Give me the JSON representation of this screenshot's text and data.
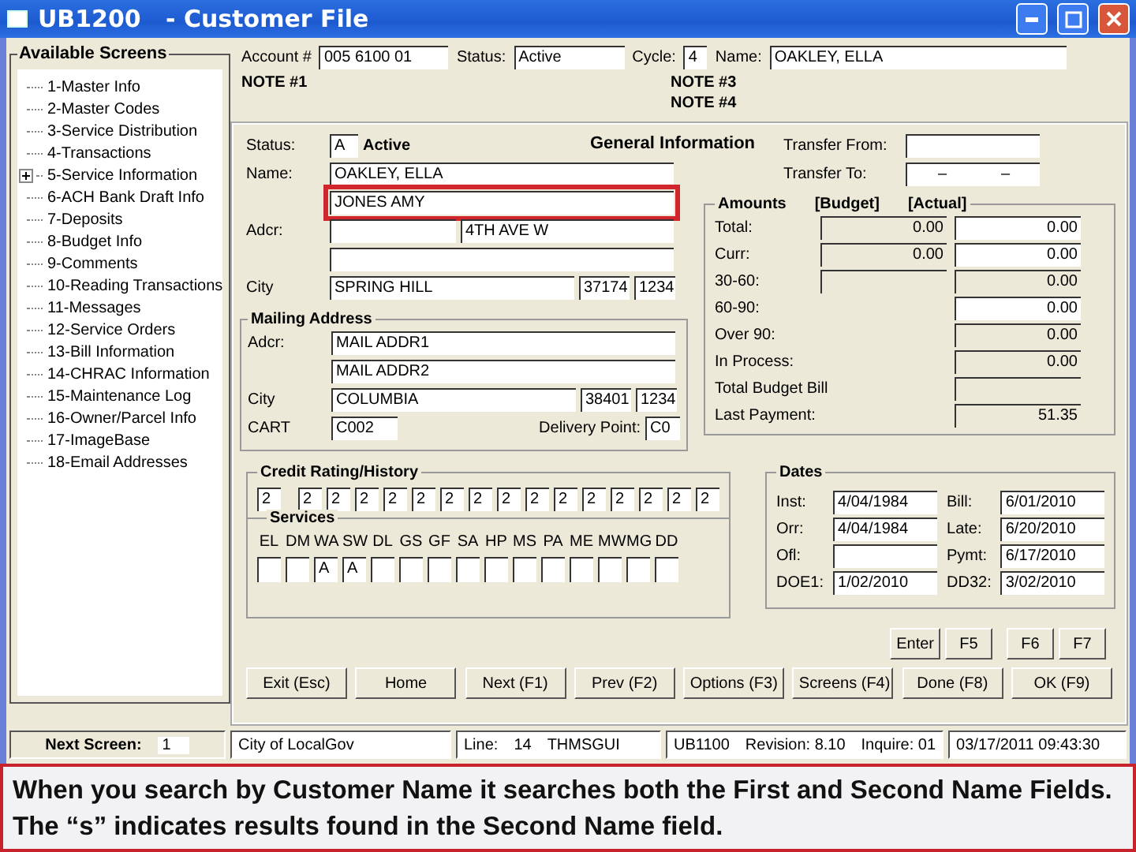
{
  "window": {
    "title": "UB1200   - Customer File"
  },
  "screens": {
    "title": "Available Screens",
    "items": [
      {
        "label": "1-Master Info",
        "expandable": false
      },
      {
        "label": "2-Master Codes",
        "expandable": false
      },
      {
        "label": "3-Service Distribution",
        "expandable": false
      },
      {
        "label": "4-Transactions",
        "expandable": false
      },
      {
        "label": "5-Service Information",
        "expandable": true
      },
      {
        "label": "6-ACH Bank Draft Info",
        "expandable": false
      },
      {
        "label": "7-Deposits",
        "expandable": false
      },
      {
        "label": "8-Budget Info",
        "expandable": false
      },
      {
        "label": "9-Comments",
        "expandable": false
      },
      {
        "label": "10-Reading Transactions",
        "expandable": false
      },
      {
        "label": "11-Messages",
        "expandable": false
      },
      {
        "label": "12-Service Orders",
        "expandable": false
      },
      {
        "label": "13-Bill Information",
        "expandable": false
      },
      {
        "label": "14-CHRAC Information",
        "expandable": false
      },
      {
        "label": "15-Maintenance Log",
        "expandable": false
      },
      {
        "label": "16-Owner/Parcel Info",
        "expandable": false
      },
      {
        "label": "17-ImageBase",
        "expandable": false
      },
      {
        "label": "18-Email Addresses",
        "expandable": false
      }
    ]
  },
  "header": {
    "account_label": "Account #",
    "account": "005  6100  01",
    "status_label": "Status:",
    "status": "Active",
    "cycle_label": "Cycle:",
    "cycle": "4",
    "name_label": "Name:",
    "name": "OAKLEY, ELLA"
  },
  "notes": {
    "left": [
      "NOTE #1"
    ],
    "right": [
      "NOTE #3",
      "NOTE #4"
    ]
  },
  "general": {
    "title": "General Information",
    "status_label": "Status:",
    "status_code": "A",
    "status_text": "Active",
    "name_label": "Name:",
    "names": [
      {
        "value": "OAKLEY, ELLA",
        "highlighted": false
      },
      {
        "value": "JONES  AMY",
        "highlighted": true
      }
    ],
    "addr_label": "Adcr:",
    "addr_lines": [
      {
        "kind": "split",
        "value": "4TH AVE W"
      },
      {
        "kind": "full"
      }
    ],
    "city_label": "City",
    "city": "SPRING HILL",
    "zip": "37174",
    "zip4": "1234",
    "transfer_from_label": "Transfer From:",
    "transfer_to_label": "Transfer To:",
    "transfer_to": [
      "–",
      "–"
    ]
  },
  "mailing": {
    "title": "Mailing Address",
    "addr_label": "Adcr:",
    "lines": [
      "MAIL ADDR1",
      "MAIL ADDR2"
    ],
    "city_label": "City",
    "city": "COLUMBIA",
    "zip": "38401",
    "zip4": "1234",
    "cart_label": "CART",
    "cart": "C002",
    "delivery_label": "Delivery Point:",
    "delivery": "C0"
  },
  "amounts": {
    "headings": [
      "Amounts",
      "[Budget]",
      "[Actual]"
    ],
    "rows": [
      {
        "label": "Total:",
        "budget_box": true,
        "budget": "0.00",
        "actual": "0.00"
      },
      {
        "label": "Curr:",
        "budget_box": true,
        "budget": "0.00",
        "actual": "0.00"
      },
      {
        "label": "30-60:",
        "budget_box": true,
        "actual": "0.00"
      },
      {
        "label": "60-90:",
        "budget_box": false,
        "actual": "0.00"
      },
      {
        "label": "Over 90:",
        "budget_box": false,
        "actual": "0.00"
      },
      {
        "label": "In Process:",
        "budget_box": false,
        "actual": "0.00"
      },
      {
        "label": "Total Budget Bill",
        "budget_box": false
      },
      {
        "label": "Last Payment:",
        "budget_box": false,
        "actual": "51.35"
      }
    ]
  },
  "credit": {
    "title": "Credit Rating/History",
    "values": [
      "2",
      "2",
      "2",
      "2",
      "2",
      "2",
      "2",
      "2",
      "2",
      "2",
      "2",
      "2",
      "2",
      "2",
      "2",
      "2"
    ]
  },
  "services": {
    "title": "Services",
    "items": [
      {
        "code": "EL"
      },
      {
        "code": "DM"
      },
      {
        "code": "WA",
        "value": "A"
      },
      {
        "code": "SW",
        "value": "A"
      },
      {
        "code": "DL"
      },
      {
        "code": "GS"
      },
      {
        "code": "GF"
      },
      {
        "code": "SA"
      },
      {
        "code": "HP"
      },
      {
        "code": "MS"
      },
      {
        "code": "PA"
      },
      {
        "code": "ME"
      },
      {
        "code": "MW"
      },
      {
        "code": "MG"
      },
      {
        "code": "DD"
      }
    ]
  },
  "dates": {
    "title": "Dates",
    "left": [
      {
        "label": "Inst:",
        "value": "4/04/1984"
      },
      {
        "label": "Orr:",
        "value": "4/04/1984"
      },
      {
        "label": "Ofl:"
      },
      {
        "label": "DOE1:",
        "value": "1/02/2010"
      }
    ],
    "right": [
      {
        "label": "Bill:",
        "value": "6/01/2010"
      },
      {
        "label": "Late:",
        "value": "6/20/2010"
      },
      {
        "label": "Pymt:",
        "value": "6/17/2010"
      },
      {
        "label": "DD32:",
        "value": "3/02/2010"
      }
    ]
  },
  "function_keys": [
    "Enter",
    "F5",
    "F6",
    "F7"
  ],
  "buttons": [
    "Exit (Esc)",
    "Home",
    "Next (F1)",
    "Prev (F2)",
    "Options (F3)",
    "Screens (F4)",
    "Done (F8)",
    "OK (F9)"
  ],
  "status_bar": {
    "next_label": "Next Screen:",
    "next": "1",
    "org": "City of LocalGov",
    "line_label": "Line:",
    "line": "14",
    "user": "THMSGUI",
    "program": "UB1100",
    "revision": "Revision:  8.10",
    "inquire": "Inquire:  01",
    "datetime": "03/17/2011  09:43:30"
  },
  "caption": "When you search by Customer Name it searches both the First and Second Name Fields. The “s” indicates results found in the Second Name field."
}
